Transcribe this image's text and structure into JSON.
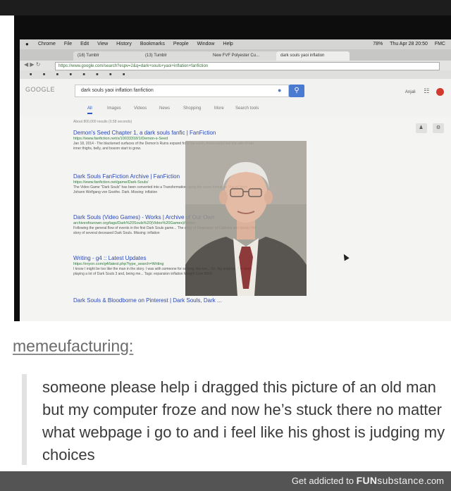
{
  "browser": {
    "menubar": {
      "items": [
        "Chrome",
        "File",
        "Edit",
        "View",
        "History",
        "Bookmarks",
        "People",
        "Window",
        "Help"
      ],
      "status": [
        "78%",
        "Thu Apr 28 20:50",
        "FMC"
      ]
    },
    "tabs": [
      "(18) Tumblr",
      "(13) Tumblr",
      "New FVF Polyester Cu...",
      "dark souls yaoi inflation"
    ],
    "url": "https://www.google.com/search?espv=2&q=dark+souls+yaoi+inflation+fanfiction"
  },
  "google": {
    "logo": "GOOGLE",
    "query": "dark souls yaoi inflation fanfiction",
    "tabs": [
      "All",
      "Images",
      "Videos",
      "News",
      "Shopping",
      "More",
      "Search tools"
    ],
    "stats": "About 800,000 results (0.58 seconds)",
    "header_right": "Anjali",
    "results": [
      {
        "title": "Demon's Seed Chapter 1, a dark souls fanfic | FanFiction",
        "url": "https://www.fanfiction.net/s/10033318/1/Demon-s-Seed",
        "snippet": "Jan 18, 2014 - The blackened surfaces of the Demon's Ruins expand from the earth. Avoid could feel the skin of her inner thighs, belly, and bosom start to grow."
      },
      {
        "title": "Dark Souls FanFiction Archive | FanFiction",
        "url": "https://www.fanfiction.net/game/Dark-Souls/",
        "snippet": "The Video Game \"Dark Souls\" has been converted into a Transformation using the same format as \"Faust\" from Johann Wolfgang von Goethe. Dark. Missing: inflation"
      },
      {
        "title": "Dark Souls (Video Games) - Works | Archive of Our Own",
        "url": "archiveofourown.org/tags/Dark%20Souls%20(Video%20Games)/works",
        "snippet": "Following the general flow of events in the first Dark Souls game... The story of Siegmeyer of Catarina and details the story of several deceased Dark Souls. Missing: inflation"
      },
      {
        "title": "Writing - g4 :: Latest Updates",
        "url": "https://eryon.com/g4/latest.php?type_search=Writing",
        "snippet": "I know I might be too like the man in the story. I was with someone for so long, like ten... So, big surprise, I've been playing a lot of Dark Souls 3 and, being me... Tags: expansion inflation Weight Gain BBW"
      },
      {
        "title": "Dark Souls & Bloodborne on Pinterest | Dark Souls, Dark ...",
        "url": "",
        "snippet": ""
      }
    ]
  },
  "post": {
    "username": "memeufacturing:",
    "text": "someone please help i dragged this picture of an old man but my computer froze and now he’s stuck there no matter what webpage i go to and i feel like his ghost is judging my choices"
  },
  "footer": {
    "prefix": "Get addicted to",
    "brand_part1": "FUN",
    "brand_part2": "substance",
    "brand_suffix": ".com"
  },
  "icons": {
    "mic": "microphone-icon",
    "search": "search-icon",
    "apps": "grid-icon",
    "notifications": "bell-icon",
    "cursor": "mouse-cursor-icon"
  },
  "colors": {
    "link": "#2b49b8",
    "url_green": "#2d7a3b",
    "google_blue": "#4a7bd0",
    "footer_bg": "#545454",
    "quote_bar": "#e2e2e2"
  }
}
